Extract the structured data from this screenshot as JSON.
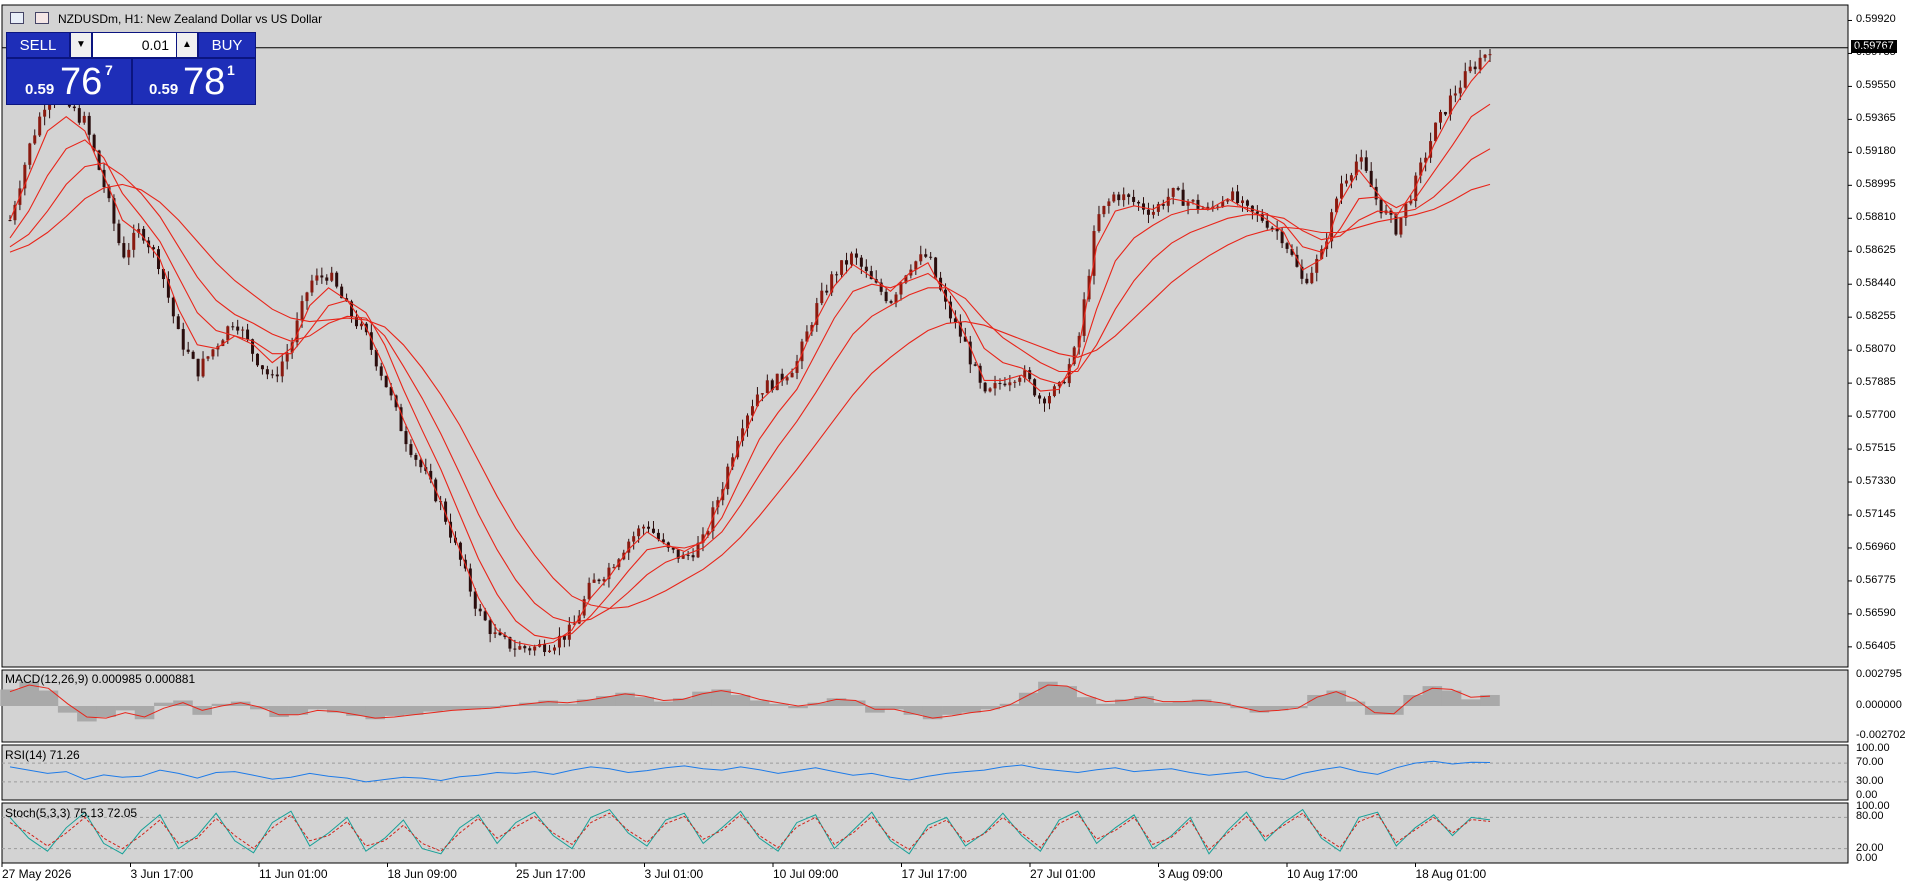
{
  "header": {
    "symbol_title": "NZDUSDm, H1:  New Zealand Dollar vs US Dollar"
  },
  "trade_panel": {
    "sell_label": "SELL",
    "buy_label": "BUY",
    "lot_value": "0.01",
    "sell_quote": {
      "small": "0.59",
      "big": "76",
      "sup": "7"
    },
    "buy_quote": {
      "small": "0.59",
      "big": "78",
      "sup": "1"
    }
  },
  "current_price_label": "0.59767",
  "colors": {
    "background": "#d3d3d3",
    "ma_line": "#e8251a",
    "candle": "#2a0d0d",
    "rsi_line": "#1e7be8",
    "stoch_main": "#17a198",
    "stoch_signal": "#d0231a",
    "macd_hist": "#a9a9a9",
    "macd_signal": "#e8251a"
  },
  "icons": [
    "chart-window-icon",
    "chart-bars-icon",
    "trade-arrow-up-icon",
    "trade-arrow-down-icon"
  ],
  "chart_data": [
    {
      "type": "line",
      "subtype": "candlestick",
      "title": "NZDUSDm, H1:  New Zealand Dollar vs US Dollar",
      "x_ticks": [
        "27 May 2026",
        "3 Jun 17:00",
        "11 Jun 01:00",
        "18 Jun 09:00",
        "25 Jun 17:00",
        "3 Jul 01:00",
        "10 Jul 09:00",
        "17 Jul 17:00",
        "27 Jul 01:00",
        "3 Aug 09:00",
        "10 Aug 17:00",
        "18 Aug 01:00"
      ],
      "y_ticks": [
        "0.59920",
        "0.59735",
        "0.59550",
        "0.59365",
        "0.59180",
        "0.58995",
        "0.58810",
        "0.58625",
        "0.58440",
        "0.58255",
        "0.58070",
        "0.57885",
        "0.57700",
        "0.57515",
        "0.57330",
        "0.57145",
        "0.56960",
        "0.56775",
        "0.56590",
        "0.56405"
      ],
      "ylim": [
        0.5632,
        0.5999
      ],
      "close_series": [
        0.588,
        0.592,
        0.595,
        0.5945,
        0.5935,
        0.59,
        0.586,
        0.5875,
        0.5855,
        0.5815,
        0.5795,
        0.581,
        0.5825,
        0.5805,
        0.579,
        0.581,
        0.5845,
        0.585,
        0.583,
        0.5815,
        0.579,
        0.576,
        0.574,
        0.572,
        0.569,
        0.566,
        0.5645,
        0.564,
        0.564,
        0.5643,
        0.565,
        0.5675,
        0.5685,
        0.57,
        0.571,
        0.5695,
        0.569,
        0.57,
        0.573,
        0.5765,
        0.5785,
        0.579,
        0.58,
        0.583,
        0.585,
        0.586,
        0.5845,
        0.5835,
        0.5855,
        0.586,
        0.583,
        0.581,
        0.578,
        0.579,
        0.5795,
        0.578,
        0.5785,
        0.581,
        0.588,
        0.5895,
        0.589,
        0.5885,
        0.5895,
        0.589,
        0.5885,
        0.5895,
        0.5885,
        0.588,
        0.587,
        0.5845,
        0.586,
        0.59,
        0.5915,
        0.589,
        0.5875,
        0.59,
        0.593,
        0.595,
        0.5965,
        0.5977
      ],
      "series": [
        {
          "values": [
            0.588,
            0.5905,
            0.593,
            0.5938,
            0.593,
            0.5905,
            0.588,
            0.5872,
            0.5858,
            0.583,
            0.581,
            0.5808,
            0.5815,
            0.581,
            0.58,
            0.5808,
            0.5832,
            0.5842,
            0.5835,
            0.582,
            0.5797,
            0.5768,
            0.5745,
            0.5722,
            0.5695,
            0.5668,
            0.565,
            0.5643,
            0.5641,
            0.5643,
            0.565,
            0.5668,
            0.568,
            0.5695,
            0.5705,
            0.5698,
            0.5694,
            0.57,
            0.5725,
            0.5755,
            0.5778,
            0.5788,
            0.5798,
            0.5823,
            0.5843,
            0.5855,
            0.5848,
            0.584,
            0.585,
            0.5856,
            0.5836,
            0.5815,
            0.579,
            0.579,
            0.5793,
            0.5784,
            0.5785,
            0.5805,
            0.5865,
            0.5885,
            0.5888,
            0.5886,
            0.5892,
            0.589,
            0.5886,
            0.5892,
            0.5886,
            0.5881,
            0.5873,
            0.5852,
            0.5858,
            0.589,
            0.5908,
            0.5895,
            0.5882,
            0.5898,
            0.5922,
            0.5942,
            0.5958,
            0.597
          ]
        },
        {
          "values": [
            0.587,
            0.5885,
            0.5905,
            0.592,
            0.5925,
            0.5915,
            0.5895,
            0.5882,
            0.5868,
            0.5848,
            0.5828,
            0.5818,
            0.5815,
            0.5812,
            0.5805,
            0.5805,
            0.5818,
            0.5832,
            0.5835,
            0.5828,
            0.581,
            0.5785,
            0.5762,
            0.574,
            0.5715,
            0.569,
            0.567,
            0.5655,
            0.5647,
            0.5645,
            0.5648,
            0.5658,
            0.567,
            0.5683,
            0.5695,
            0.5697,
            0.5696,
            0.5699,
            0.5713,
            0.5735,
            0.5757,
            0.5772,
            0.5785,
            0.5805,
            0.5825,
            0.584,
            0.5844,
            0.5842,
            0.5846,
            0.585,
            0.5842,
            0.5828,
            0.5808,
            0.58,
            0.5797,
            0.5791,
            0.5788,
            0.5797,
            0.583,
            0.5857,
            0.587,
            0.5877,
            0.5883,
            0.5886,
            0.5886,
            0.5888,
            0.5887,
            0.5884,
            0.5878,
            0.5865,
            0.5862,
            0.5875,
            0.5892,
            0.5893,
            0.5887,
            0.5892,
            0.5907,
            0.5922,
            0.5938,
            0.5945
          ]
        },
        {
          "values": [
            0.5865,
            0.5872,
            0.5885,
            0.59,
            0.591,
            0.5912,
            0.5905,
            0.5895,
            0.5882,
            0.5865,
            0.5848,
            0.5835,
            0.5827,
            0.5822,
            0.5816,
            0.5812,
            0.5815,
            0.5822,
            0.5826,
            0.5825,
            0.5815,
            0.5798,
            0.578,
            0.576,
            0.5738,
            0.5715,
            0.5695,
            0.5678,
            0.5665,
            0.5657,
            0.5654,
            0.5656,
            0.5662,
            0.5671,
            0.5681,
            0.5688,
            0.5692,
            0.5696,
            0.5705,
            0.572,
            0.5737,
            0.5753,
            0.5767,
            0.5783,
            0.58,
            0.5816,
            0.5826,
            0.5832,
            0.5838,
            0.5842,
            0.5842,
            0.5836,
            0.5824,
            0.5814,
            0.5807,
            0.58,
            0.5795,
            0.5795,
            0.581,
            0.583,
            0.5846,
            0.5858,
            0.5867,
            0.5873,
            0.5877,
            0.5881,
            0.5883,
            0.5883,
            0.5881,
            0.5874,
            0.5869,
            0.5871,
            0.588,
            0.5885,
            0.5884,
            0.5886,
            0.5893,
            0.5903,
            0.5914,
            0.592
          ]
        },
        {
          "values": [
            0.5862,
            0.5866,
            0.5873,
            0.5882,
            0.5892,
            0.5898,
            0.59,
            0.5897,
            0.589,
            0.588,
            0.5868,
            0.5856,
            0.5846,
            0.5838,
            0.583,
            0.5825,
            0.5823,
            0.5824,
            0.5825,
            0.5824,
            0.582,
            0.581,
            0.5797,
            0.5782,
            0.5765,
            0.5745,
            0.5725,
            0.5707,
            0.5692,
            0.5679,
            0.5669,
            0.5664,
            0.5662,
            0.5663,
            0.5667,
            0.5672,
            0.5678,
            0.5684,
            0.5692,
            0.5702,
            0.5714,
            0.5727,
            0.574,
            0.5754,
            0.5768,
            0.5782,
            0.5794,
            0.5803,
            0.5811,
            0.5818,
            0.5822,
            0.5823,
            0.5821,
            0.5817,
            0.5813,
            0.5809,
            0.5805,
            0.5803,
            0.5807,
            0.5815,
            0.5825,
            0.5835,
            0.5845,
            0.5853,
            0.586,
            0.5866,
            0.5871,
            0.5874,
            0.5876,
            0.5875,
            0.5873,
            0.5873,
            0.5876,
            0.5879,
            0.5881,
            0.5883,
            0.5886,
            0.5891,
            0.5897,
            0.59
          ]
        }
      ]
    },
    {
      "type": "line",
      "title": "MACD(12,26,9) 0.000985 0.000881",
      "y_ticks": [
        "0.002795",
        "0.000000",
        "-0.002702"
      ],
      "ylim": [
        -0.0029,
        0.0029
      ],
      "histogram_values": [
        0.0015,
        0.0022,
        0.0014,
        -0.0006,
        -0.0014,
        -0.001,
        -0.0004,
        -0.0012,
        0.0003,
        0.0005,
        -0.0008,
        0.0002,
        0.0004,
        -0.0003,
        -0.001,
        -0.0008,
        -0.0003,
        -0.0006,
        -0.0009,
        -0.0012,
        -0.0009,
        -0.0008,
        -0.0005,
        -0.0004,
        -0.0003,
        -0.0002,
        0.0001,
        0.0003,
        0.0005,
        0.0002,
        0.0006,
        0.0009,
        0.0012,
        0.0008,
        0.0004,
        0.0007,
        0.0013,
        0.0015,
        0.001,
        0.0005,
        0.0002,
        -0.0002,
        0.0003,
        0.0007,
        0.0005,
        -0.0006,
        -0.0003,
        -0.0008,
        -0.0012,
        -0.0008,
        -0.0006,
        -0.0003,
        0.0002,
        0.0012,
        0.0022,
        0.0018,
        0.0008,
        0.0002,
        0.0006,
        0.0009,
        0.0003,
        0.0004,
        0.0006,
        0.0003,
        -0.0002,
        -0.0006,
        -0.0004,
        -0.0002,
        0.001,
        0.0014,
        0.0004,
        -0.0008,
        -0.0008,
        0.001,
        0.0018,
        0.0014,
        0.0006,
        0.001
      ],
      "signal_values": [
        0.0013,
        0.0019,
        0.0016,
        0.0002,
        -0.001,
        -0.0011,
        -0.0006,
        -0.001,
        -0.0002,
        0.0003,
        -0.0004,
        0.0,
        0.0003,
        -0.0001,
        -0.0008,
        -0.0008,
        -0.0004,
        -0.0005,
        -0.0008,
        -0.0011,
        -0.001,
        -0.0008,
        -0.0006,
        -0.0004,
        -0.0003,
        -0.0002,
        0.0,
        0.0002,
        0.0004,
        0.0003,
        0.0005,
        0.0008,
        0.0011,
        0.0009,
        0.0005,
        0.0006,
        0.0011,
        0.0014,
        0.0011,
        0.0006,
        0.0003,
        0.0,
        0.0002,
        0.0006,
        0.0005,
        -0.0003,
        -0.0003,
        -0.0007,
        -0.0011,
        -0.0009,
        -0.0006,
        -0.0004,
        0.0001,
        0.001,
        0.0019,
        0.0018,
        0.001,
        0.0004,
        0.0005,
        0.0008,
        0.0004,
        0.0004,
        0.0005,
        0.0003,
        -0.0001,
        -0.0005,
        -0.0004,
        -0.0002,
        0.0008,
        0.0013,
        0.0006,
        -0.0006,
        -0.0007,
        0.0008,
        0.0016,
        0.0015,
        0.0008,
        0.0009
      ]
    },
    {
      "type": "line",
      "title": "RSI(14) 71.26",
      "y_ticks": [
        "100.00",
        "70.00",
        "30.00",
        "0.00"
      ],
      "ylim": [
        0,
        100
      ],
      "levels": [
        70,
        30
      ],
      "values": [
        62,
        55,
        48,
        52,
        35,
        45,
        40,
        42,
        55,
        48,
        38,
        50,
        52,
        44,
        36,
        40,
        48,
        42,
        38,
        30,
        35,
        40,
        38,
        33,
        41,
        44,
        50,
        48,
        52,
        46,
        55,
        62,
        58,
        50,
        54,
        60,
        64,
        58,
        55,
        62,
        56,
        48,
        54,
        60,
        52,
        44,
        48,
        40,
        34,
        42,
        48,
        52,
        55,
        62,
        66,
        58,
        54,
        50,
        56,
        60,
        52,
        55,
        58,
        50,
        44,
        48,
        52,
        40,
        35,
        48,
        56,
        62,
        52,
        46,
        60,
        70,
        74,
        68,
        72,
        71.26
      ]
    },
    {
      "type": "line",
      "title": "Stoch(5,3,3) 75.13 72.05",
      "y_ticks": [
        "100.00",
        "80.00",
        "20.00",
        "0.00"
      ],
      "ylim": [
        0,
        100
      ],
      "levels": [
        80,
        20
      ],
      "main_values": [
        80,
        40,
        15,
        60,
        90,
        30,
        10,
        55,
        85,
        20,
        45,
        88,
        35,
        12,
        70,
        92,
        25,
        50,
        80,
        15,
        40,
        75,
        20,
        10,
        60,
        85,
        30,
        70,
        90,
        45,
        20,
        80,
        95,
        50,
        25,
        75,
        88,
        30,
        60,
        92,
        40,
        15,
        70,
        85,
        20,
        55,
        90,
        35,
        10,
        65,
        80,
        25,
        50,
        88,
        45,
        15,
        75,
        92,
        30,
        60,
        85,
        20,
        45,
        80,
        10,
        55,
        90,
        35,
        70,
        95,
        40,
        15,
        80,
        90,
        25,
        60,
        85,
        45,
        80,
        75.13
      ],
      "signal_values": [
        70,
        50,
        25,
        50,
        80,
        40,
        20,
        45,
        75,
        30,
        40,
        78,
        45,
        20,
        60,
        85,
        35,
        45,
        72,
        25,
        35,
        65,
        30,
        15,
        50,
        78,
        40,
        62,
        82,
        50,
        28,
        70,
        88,
        55,
        32,
        68,
        82,
        38,
        55,
        85,
        45,
        22,
        62,
        80,
        28,
        50,
        82,
        40,
        18,
        58,
        75,
        32,
        48,
        80,
        50,
        22,
        68,
        86,
        38,
        55,
        80,
        28,
        42,
        74,
        18,
        50,
        82,
        42,
        65,
        88,
        45,
        22,
        72,
        86,
        32,
        56,
        80,
        50,
        76,
        72.05
      ]
    }
  ]
}
